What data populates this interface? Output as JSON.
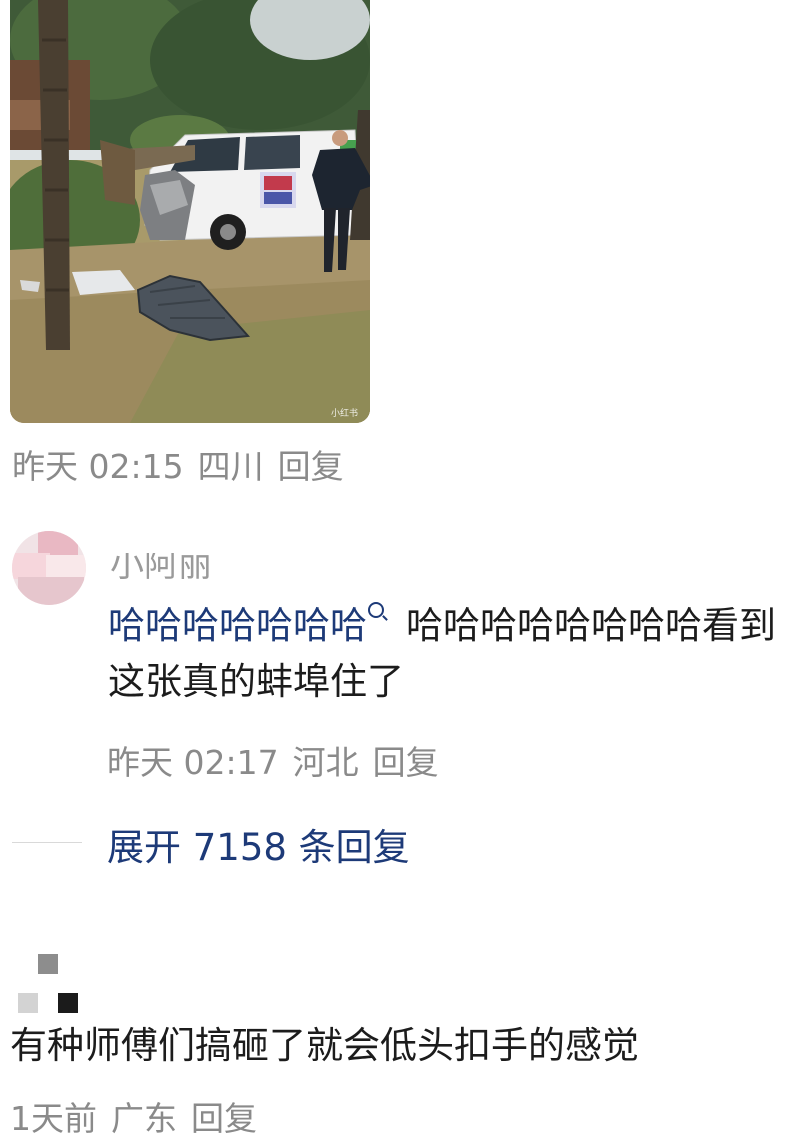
{
  "photo": {
    "watermark": "小红书"
  },
  "comments": [
    {
      "meta": {
        "time": "昨天 02:15",
        "location": "四川",
        "reply_label": "回复"
      }
    },
    {
      "username": "小阿丽",
      "text_link": "哈哈哈哈哈哈哈",
      "text_rest": "哈哈哈哈哈哈哈哈看到这张真的蚌埠住了",
      "meta": {
        "time": "昨天 02:17",
        "location": "河北",
        "reply_label": "回复"
      },
      "expand_label": "展开 7158 条回复"
    },
    {
      "text": "有种师傅们搞砸了就会低头扣手的感觉",
      "meta": {
        "time": "1天前",
        "location": "广东",
        "reply_label": "回复"
      }
    }
  ],
  "colors": {
    "link": "#1d3a78",
    "meta": "#8a8a8a",
    "text": "#1c1c1c"
  }
}
